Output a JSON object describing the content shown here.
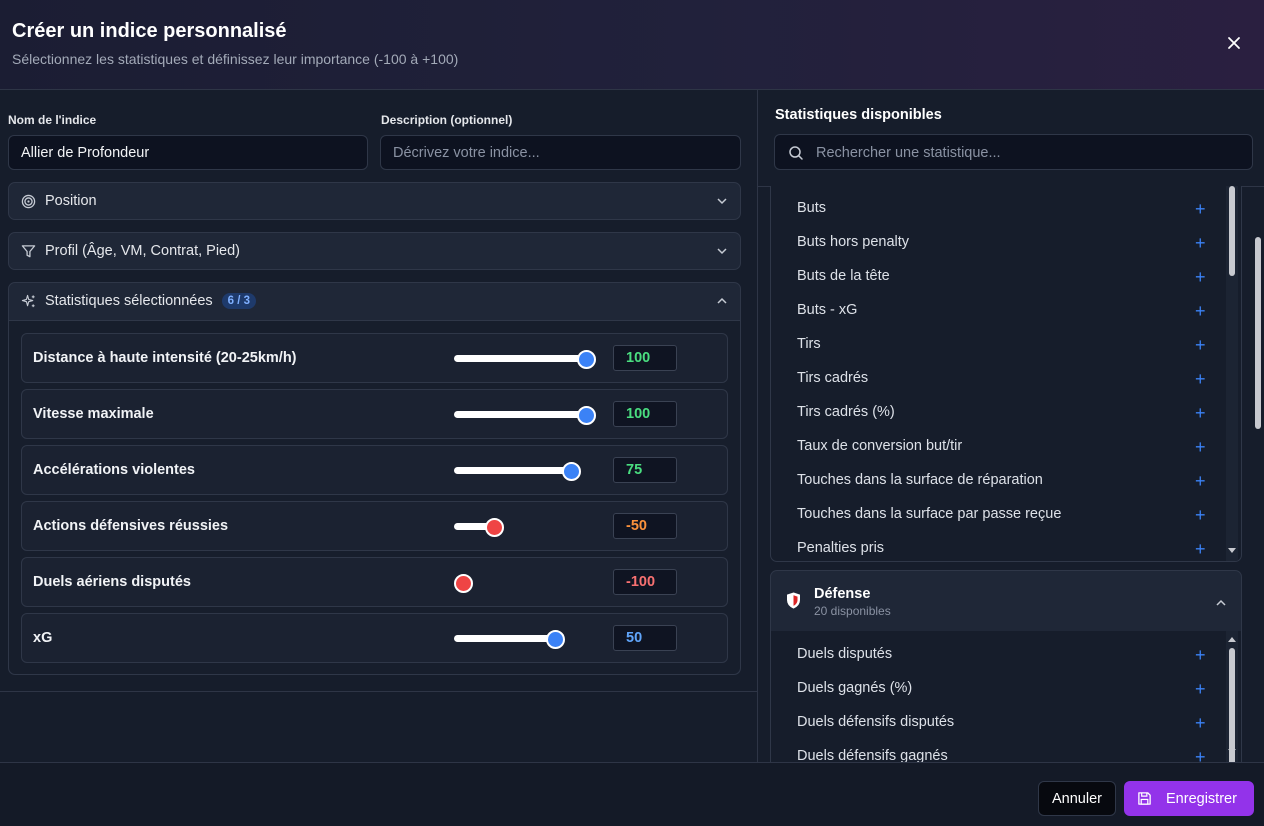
{
  "dialog": {
    "title": "Créer un indice personnalisé",
    "subtitle": "Sélectionnez les statistiques et définissez leur importance (-100 à +100)"
  },
  "form": {
    "name_label": "Nom de l'indice",
    "name_value": "Allier de Profondeur",
    "description_label": "Description (optionnel)",
    "description_placeholder": "Décrivez votre indice..."
  },
  "sections": {
    "position": "Position",
    "profile": "Profil (Âge, VM, Contrat, Pied)",
    "selected": "Statistiques sélectionnées",
    "selected_badge": "6 / 3"
  },
  "selected_stats": [
    {
      "name": "Distance à haute intensité (20-25km/h)",
      "value": "100",
      "level": 1.0,
      "color": "#3b82f6",
      "text_color": "#4ade80"
    },
    {
      "name": "Vitesse maximale",
      "value": "100",
      "level": 1.0,
      "color": "#3b82f6",
      "text_color": "#4ade80"
    },
    {
      "name": "Accélérations violentes",
      "value": "75",
      "level": 0.875,
      "color": "#3b82f6",
      "text_color": "#4ade80"
    },
    {
      "name": "Actions défensives réussies",
      "value": "-50",
      "level": 0.25,
      "color": "#ef4444",
      "text_color": "#fb923c"
    },
    {
      "name": "Duels aériens disputés",
      "value": "-100",
      "level": 0.0,
      "color": "#ef4444",
      "text_color": "#f87171"
    },
    {
      "name": "xG",
      "value": "50",
      "level": 0.75,
      "color": "#3b82f6",
      "text_color": "#60a5fa"
    }
  ],
  "available": {
    "title": "Statistiques disponibles",
    "search_placeholder": "Rechercher une statistique...",
    "attack_items": [
      "Buts",
      "Buts hors penalty",
      "Buts de la tête",
      "Buts - xG",
      "Tirs",
      "Tirs cadrés",
      "Tirs cadrés (%)",
      "Taux de conversion but/tir",
      "Touches dans la surface de réparation",
      "Touches dans la surface par passe reçue",
      "Penalties pris"
    ],
    "defense_category": {
      "name": "Défense",
      "count": "20 disponibles",
      "items": [
        "Duels disputés",
        "Duels gagnés (%)",
        "Duels défensifs disputés",
        "Duels défensifs gagnés"
      ]
    },
    "add_icon": "plus-icon"
  },
  "footer": {
    "cancel": "Annuler",
    "save": "Enregistrer"
  },
  "colors": {
    "accent": "#9333ea",
    "plus": "#3b82f6"
  }
}
